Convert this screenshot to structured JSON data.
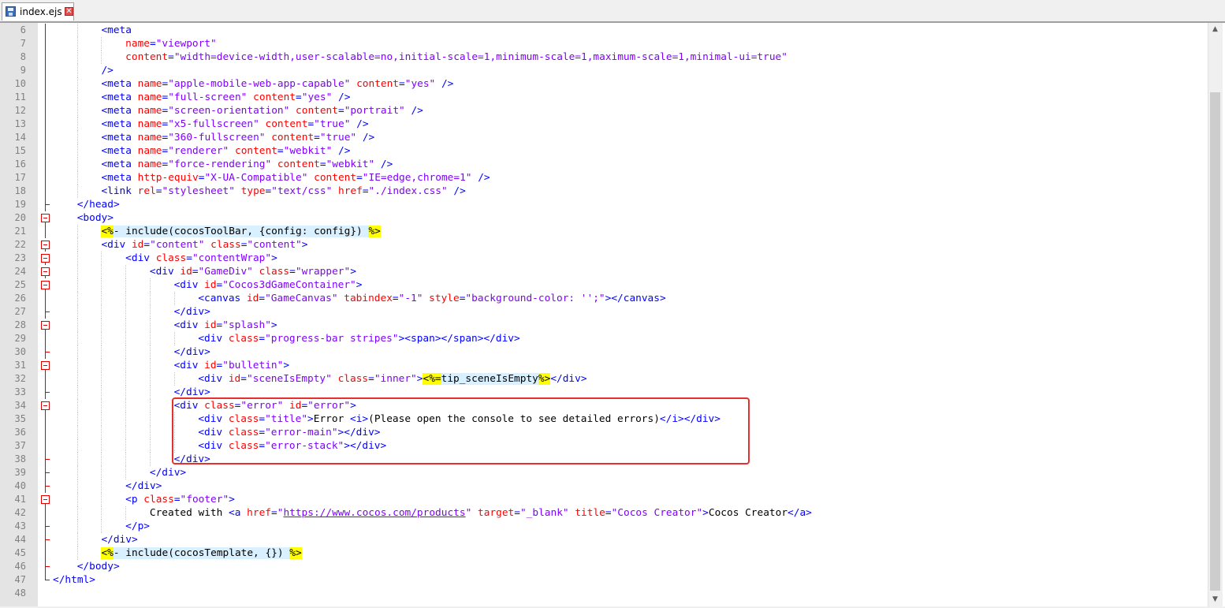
{
  "tab": {
    "filename": "index.ejs",
    "save_icon": "save-icon",
    "close_icon": "close-icon",
    "close_glyph": "✕"
  },
  "scrollbar": {
    "up_glyph": "▲",
    "down_glyph": "▼"
  },
  "colors": {
    "tag": "#0000ff",
    "attribute": "#ff0000",
    "string": "#8000ff",
    "ejs_delimiter_bg": "#ffff00",
    "ejs_bg": "#d8f0ff",
    "highlight_box": "#e53030",
    "fold_marker": "#e00000"
  },
  "lines": [
    {
      "n": "6",
      "indent": 2,
      "fold": "line",
      "tokens": [
        [
          "t",
          "<meta"
        ]
      ]
    },
    {
      "n": "7",
      "indent": 3,
      "fold": "line",
      "tokens": [
        [
          "a",
          "name"
        ],
        [
          "t",
          "="
        ],
        [
          "s",
          "\"viewport\""
        ]
      ]
    },
    {
      "n": "8",
      "indent": 3,
      "fold": "line",
      "tokens": [
        [
          "a",
          "content"
        ],
        [
          "t",
          "="
        ],
        [
          "s",
          "\"width=device-width,user-scalable=no,initial-scale=1,minimum-scale=1,maximum-scale=1,minimal-ui=true\""
        ]
      ]
    },
    {
      "n": "9",
      "indent": 2,
      "fold": "line",
      "tokens": [
        [
          "t",
          "/>"
        ]
      ]
    },
    {
      "n": "10",
      "indent": 2,
      "fold": "line",
      "tokens": [
        [
          "t",
          "<meta "
        ],
        [
          "a",
          "name"
        ],
        [
          "t",
          "="
        ],
        [
          "s",
          "\"apple-mobile-web-app-capable\""
        ],
        [
          "t",
          " "
        ],
        [
          "a",
          "content"
        ],
        [
          "t",
          "="
        ],
        [
          "s",
          "\"yes\""
        ],
        [
          "t",
          " />"
        ]
      ]
    },
    {
      "n": "11",
      "indent": 2,
      "fold": "line",
      "tokens": [
        [
          "t",
          "<meta "
        ],
        [
          "a",
          "name"
        ],
        [
          "t",
          "="
        ],
        [
          "s",
          "\"full-screen\""
        ],
        [
          "t",
          " "
        ],
        [
          "a",
          "content"
        ],
        [
          "t",
          "="
        ],
        [
          "s",
          "\"yes\""
        ],
        [
          "t",
          " />"
        ]
      ]
    },
    {
      "n": "12",
      "indent": 2,
      "fold": "line",
      "tokens": [
        [
          "t",
          "<meta "
        ],
        [
          "a",
          "name"
        ],
        [
          "t",
          "="
        ],
        [
          "s",
          "\"screen-orientation\""
        ],
        [
          "t",
          " "
        ],
        [
          "a",
          "content"
        ],
        [
          "t",
          "="
        ],
        [
          "s",
          "\"portrait\""
        ],
        [
          "t",
          " />"
        ]
      ]
    },
    {
      "n": "13",
      "indent": 2,
      "fold": "line",
      "tokens": [
        [
          "t",
          "<meta "
        ],
        [
          "a",
          "name"
        ],
        [
          "t",
          "="
        ],
        [
          "s",
          "\"x5-fullscreen\""
        ],
        [
          "t",
          " "
        ],
        [
          "a",
          "content"
        ],
        [
          "t",
          "="
        ],
        [
          "s",
          "\"true\""
        ],
        [
          "t",
          " />"
        ]
      ]
    },
    {
      "n": "14",
      "indent": 2,
      "fold": "line",
      "tokens": [
        [
          "t",
          "<meta "
        ],
        [
          "a",
          "name"
        ],
        [
          "t",
          "="
        ],
        [
          "s",
          "\"360-fullscreen\""
        ],
        [
          "t",
          " "
        ],
        [
          "a",
          "content"
        ],
        [
          "t",
          "="
        ],
        [
          "s",
          "\"true\""
        ],
        [
          "t",
          " />"
        ]
      ]
    },
    {
      "n": "15",
      "indent": 2,
      "fold": "line",
      "tokens": [
        [
          "t",
          "<meta "
        ],
        [
          "a",
          "name"
        ],
        [
          "t",
          "="
        ],
        [
          "s",
          "\"renderer\""
        ],
        [
          "t",
          " "
        ],
        [
          "a",
          "content"
        ],
        [
          "t",
          "="
        ],
        [
          "s",
          "\"webkit\""
        ],
        [
          "t",
          " />"
        ]
      ]
    },
    {
      "n": "16",
      "indent": 2,
      "fold": "line",
      "tokens": [
        [
          "t",
          "<meta "
        ],
        [
          "a",
          "name"
        ],
        [
          "t",
          "="
        ],
        [
          "s",
          "\"force-rendering\""
        ],
        [
          "t",
          " "
        ],
        [
          "a",
          "content"
        ],
        [
          "t",
          "="
        ],
        [
          "s",
          "\"webkit\""
        ],
        [
          "t",
          " />"
        ]
      ]
    },
    {
      "n": "17",
      "indent": 2,
      "fold": "line",
      "tokens": [
        [
          "t",
          "<meta "
        ],
        [
          "a",
          "http-equiv"
        ],
        [
          "t",
          "="
        ],
        [
          "s",
          "\"X-UA-Compatible\""
        ],
        [
          "t",
          " "
        ],
        [
          "a",
          "content"
        ],
        [
          "t",
          "="
        ],
        [
          "s",
          "\"IE=edge,chrome=1\""
        ],
        [
          "t",
          " />"
        ]
      ]
    },
    {
      "n": "18",
      "indent": 2,
      "fold": "line",
      "tokens": [
        [
          "t",
          "<link "
        ],
        [
          "a",
          "rel"
        ],
        [
          "t",
          "="
        ],
        [
          "s",
          "\"stylesheet\""
        ],
        [
          "t",
          " "
        ],
        [
          "a",
          "type"
        ],
        [
          "t",
          "="
        ],
        [
          "s",
          "\"text/css\""
        ],
        [
          "t",
          " "
        ],
        [
          "a",
          "href"
        ],
        [
          "t",
          "="
        ],
        [
          "s",
          "\"./index.css\""
        ],
        [
          "t",
          " />"
        ]
      ]
    },
    {
      "n": "19",
      "indent": 1,
      "fold": "end",
      "tokens": [
        [
          "t",
          "</head>"
        ]
      ]
    },
    {
      "n": "20",
      "indent": 1,
      "fold": "box",
      "tokens": [
        [
          "t",
          "<body>"
        ]
      ]
    },
    {
      "n": "21",
      "indent": 2,
      "fold": "line",
      "tokens": [
        [
          "hl",
          "<%"
        ],
        [
          "ej",
          "- include(cocosToolBar, {config: config}) "
        ],
        [
          "hl",
          "%>"
        ]
      ]
    },
    {
      "n": "22",
      "indent": 2,
      "fold": "box",
      "tokens": [
        [
          "t",
          "<div "
        ],
        [
          "a",
          "id"
        ],
        [
          "t",
          "="
        ],
        [
          "s",
          "\"content\""
        ],
        [
          "t",
          " "
        ],
        [
          "a",
          "class"
        ],
        [
          "t",
          "="
        ],
        [
          "s",
          "\"content\""
        ],
        [
          "t",
          ">"
        ]
      ]
    },
    {
      "n": "23",
      "indent": 3,
      "fold": "box",
      "tokens": [
        [
          "t",
          "<div "
        ],
        [
          "a",
          "class"
        ],
        [
          "t",
          "="
        ],
        [
          "s",
          "\"contentWrap\""
        ],
        [
          "t",
          ">"
        ]
      ]
    },
    {
      "n": "24",
      "indent": 4,
      "fold": "box",
      "tokens": [
        [
          "t",
          "<div "
        ],
        [
          "a",
          "id"
        ],
        [
          "t",
          "="
        ],
        [
          "s",
          "\"GameDiv\""
        ],
        [
          "t",
          " "
        ],
        [
          "a",
          "class"
        ],
        [
          "t",
          "="
        ],
        [
          "s",
          "\"wrapper\""
        ],
        [
          "t",
          ">"
        ]
      ]
    },
    {
      "n": "25",
      "indent": 5,
      "fold": "box",
      "tokens": [
        [
          "t",
          "<div "
        ],
        [
          "a",
          "id"
        ],
        [
          "t",
          "="
        ],
        [
          "s",
          "\"Cocos3dGameContainer\""
        ],
        [
          "t",
          ">"
        ]
      ]
    },
    {
      "n": "26",
      "indent": 6,
      "fold": "line",
      "tokens": [
        [
          "t",
          "<canvas "
        ],
        [
          "a",
          "id"
        ],
        [
          "t",
          "="
        ],
        [
          "s",
          "\"GameCanvas\""
        ],
        [
          "t",
          " "
        ],
        [
          "a",
          "tabindex"
        ],
        [
          "t",
          "="
        ],
        [
          "s",
          "\"-1\""
        ],
        [
          "t",
          " "
        ],
        [
          "a",
          "style"
        ],
        [
          "t",
          "="
        ],
        [
          "s",
          "\"background-color: '';\""
        ],
        [
          "t",
          "></canvas>"
        ]
      ]
    },
    {
      "n": "27",
      "indent": 5,
      "fold": "end",
      "tokens": [
        [
          "t",
          "</div>"
        ]
      ]
    },
    {
      "n": "28",
      "indent": 5,
      "fold": "box",
      "tokens": [
        [
          "t",
          "<div "
        ],
        [
          "a",
          "id"
        ],
        [
          "t",
          "="
        ],
        [
          "s",
          "\"splash\""
        ],
        [
          "t",
          ">"
        ]
      ]
    },
    {
      "n": "29",
      "indent": 6,
      "fold": "line",
      "tokens": [
        [
          "t",
          "<div "
        ],
        [
          "a",
          "class"
        ],
        [
          "t",
          "="
        ],
        [
          "s",
          "\"progress-bar stripes\""
        ],
        [
          "t",
          "><span></span></div>"
        ]
      ]
    },
    {
      "n": "30",
      "indent": 5,
      "fold": "end",
      "tokens": [
        [
          "t",
          "</div>"
        ]
      ]
    },
    {
      "n": "31",
      "indent": 5,
      "fold": "box",
      "tokens": [
        [
          "t",
          "<div "
        ],
        [
          "a",
          "id"
        ],
        [
          "t",
          "="
        ],
        [
          "s",
          "\"bulletin\""
        ],
        [
          "t",
          ">"
        ]
      ]
    },
    {
      "n": "32",
      "indent": 6,
      "fold": "line",
      "tokens": [
        [
          "t",
          "<div "
        ],
        [
          "a",
          "id"
        ],
        [
          "t",
          "="
        ],
        [
          "s",
          "\"sceneIsEmpty\""
        ],
        [
          "t",
          " "
        ],
        [
          "a",
          "class"
        ],
        [
          "t",
          "="
        ],
        [
          "s",
          "\"inner\""
        ],
        [
          "t",
          ">"
        ],
        [
          "hl",
          "<%="
        ],
        [
          "ej",
          "tip_sceneIsEmpty"
        ],
        [
          "hl",
          "%>"
        ],
        [
          "t",
          "</div>"
        ]
      ]
    },
    {
      "n": "33",
      "indent": 5,
      "fold": "end",
      "tokens": [
        [
          "t",
          "</div>"
        ]
      ]
    },
    {
      "n": "34",
      "indent": 5,
      "fold": "box",
      "tokens": [
        [
          "t",
          "<div "
        ],
        [
          "a",
          "class"
        ],
        [
          "t",
          "="
        ],
        [
          "s",
          "\"error\""
        ],
        [
          "t",
          " "
        ],
        [
          "a",
          "id"
        ],
        [
          "t",
          "="
        ],
        [
          "s",
          "\"error\""
        ],
        [
          "t",
          ">"
        ]
      ]
    },
    {
      "n": "35",
      "indent": 6,
      "fold": "line",
      "tokens": [
        [
          "t",
          "<div "
        ],
        [
          "a",
          "class"
        ],
        [
          "t",
          "="
        ],
        [
          "s",
          "\"title\""
        ],
        [
          "t",
          ">"
        ],
        [
          "x",
          "Error "
        ],
        [
          "t",
          "<i>"
        ],
        [
          "x",
          "(Please open the console to see detailed errors)"
        ],
        [
          "t",
          "</i></div>"
        ]
      ]
    },
    {
      "n": "36",
      "indent": 6,
      "fold": "line",
      "tokens": [
        [
          "t",
          "<div "
        ],
        [
          "a",
          "class"
        ],
        [
          "t",
          "="
        ],
        [
          "s",
          "\"error-main\""
        ],
        [
          "t",
          "></div>"
        ]
      ]
    },
    {
      "n": "37",
      "indent": 6,
      "fold": "line",
      "tokens": [
        [
          "t",
          "<div "
        ],
        [
          "a",
          "class"
        ],
        [
          "t",
          "="
        ],
        [
          "s",
          "\"error-stack\""
        ],
        [
          "t",
          "></div>"
        ]
      ]
    },
    {
      "n": "38",
      "indent": 5,
      "fold": "end",
      "tokens": [
        [
          "t",
          "</div>"
        ]
      ]
    },
    {
      "n": "39",
      "indent": 4,
      "fold": "end",
      "tokens": [
        [
          "t",
          "</div>"
        ]
      ]
    },
    {
      "n": "40",
      "indent": 3,
      "fold": "end",
      "tokens": [
        [
          "t",
          "</div>"
        ]
      ]
    },
    {
      "n": "41",
      "indent": 3,
      "fold": "box",
      "tokens": [
        [
          "t",
          "<p "
        ],
        [
          "a",
          "class"
        ],
        [
          "t",
          "="
        ],
        [
          "s",
          "\"footer\""
        ],
        [
          "t",
          ">"
        ]
      ]
    },
    {
      "n": "42",
      "indent": 4,
      "fold": "line",
      "tokens": [
        [
          "x",
          "Created with "
        ],
        [
          "t",
          "<a "
        ],
        [
          "a",
          "href"
        ],
        [
          "t",
          "="
        ],
        [
          "s",
          "\""
        ],
        [
          "su",
          "https://www.cocos.com/products"
        ],
        [
          "s",
          "\""
        ],
        [
          "t",
          " "
        ],
        [
          "a",
          "target"
        ],
        [
          "t",
          "="
        ],
        [
          "s",
          "\"_blank\""
        ],
        [
          "t",
          " "
        ],
        [
          "a",
          "title"
        ],
        [
          "t",
          "="
        ],
        [
          "s",
          "\"Cocos Creator\""
        ],
        [
          "t",
          ">"
        ],
        [
          "x",
          "Cocos Creator"
        ],
        [
          "t",
          "</a>"
        ]
      ]
    },
    {
      "n": "43",
      "indent": 3,
      "fold": "end",
      "tokens": [
        [
          "t",
          "</p>"
        ]
      ]
    },
    {
      "n": "44",
      "indent": 2,
      "fold": "end",
      "tokens": [
        [
          "t",
          "</div>"
        ]
      ]
    },
    {
      "n": "45",
      "indent": 2,
      "fold": "line",
      "tokens": [
        [
          "hl",
          "<%"
        ],
        [
          "ej",
          "- include(cocosTemplate, {}) "
        ],
        [
          "hl",
          "%>"
        ]
      ]
    },
    {
      "n": "46",
      "indent": 1,
      "fold": "end",
      "tokens": [
        [
          "t",
          "</body>"
        ]
      ]
    },
    {
      "n": "47",
      "indent": 0,
      "fold": "corner",
      "tokens": [
        [
          "t",
          "</html>"
        ]
      ]
    },
    {
      "n": "48",
      "indent": 0,
      "fold": "none",
      "tokens": []
    }
  ]
}
